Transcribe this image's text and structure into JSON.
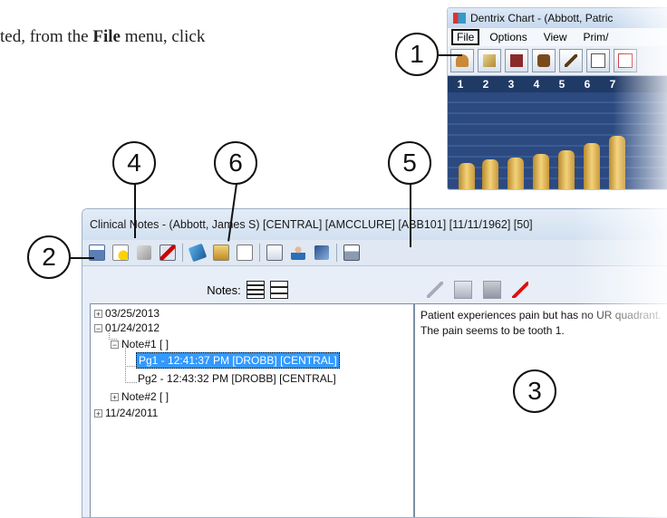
{
  "instruction": {
    "before": "ted, from the ",
    "bold": "File",
    "after": " menu, click"
  },
  "chart": {
    "title": "Dentrix Chart - (Abbott, Patric",
    "menu": [
      "File",
      "Options",
      "View",
      "Prim/"
    ],
    "tooth_numbers": [
      "1",
      "2",
      "3",
      "4",
      "5",
      "6",
      "7"
    ],
    "toolbar_icons": [
      "patient-icon",
      "notes-icon",
      "book-icon",
      "chair-icon",
      "pen-icon",
      "eraser-icon",
      "card-icon"
    ]
  },
  "callouts": [
    "1",
    "2",
    "3",
    "4",
    "5",
    "6"
  ],
  "notes_window": {
    "title": "Clinical Notes - (Abbott, James S) [CENTRAL] [AMCCLURE] [ABB101] [11/11/1962] [50]",
    "notes_label": "Notes:",
    "tree": [
      {
        "label": "03/25/2013",
        "expander": "+"
      },
      {
        "label": "01/24/2012",
        "expander": "−"
      },
      {
        "label": "Note#1 [ ]",
        "expander": "−"
      },
      {
        "label": "Pg1 - 12:41:37 PM [DROBB] [CENTRAL]",
        "selected": true
      },
      {
        "label": "Pg2 - 12:43:32 PM [DROBB] [CENTRAL]"
      },
      {
        "label": "Note#2 [ ]",
        "expander": "+"
      },
      {
        "label": "11/24/2011",
        "expander": "+"
      }
    ],
    "note_text": "Patient experiences pain but has no UR quadrant. The pain seems to be tooth 1."
  },
  "colors": {
    "selection": "#3399ff",
    "chart_background": "#203a66",
    "window_chrome": "#dfe8f3"
  }
}
